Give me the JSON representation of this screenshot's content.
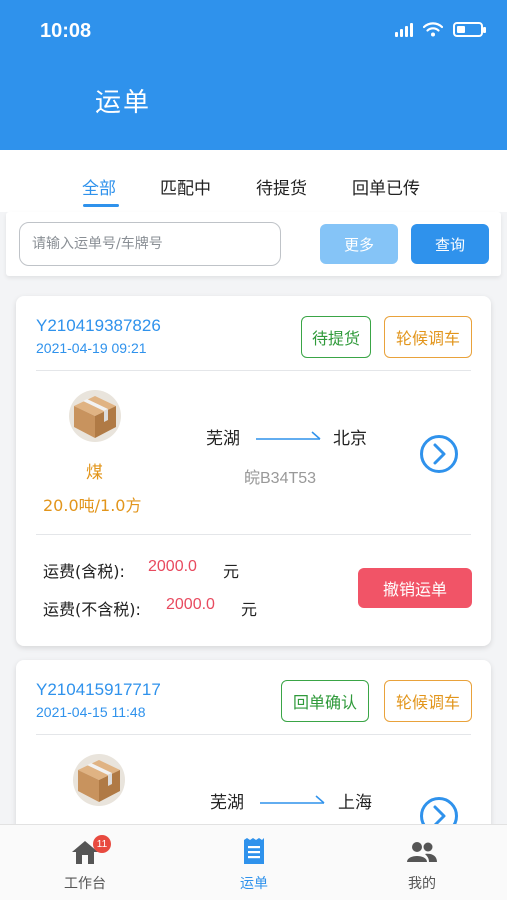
{
  "status_bar": {
    "time": "10:08"
  },
  "header": {
    "title": "运单"
  },
  "tabs": [
    {
      "label": "全部",
      "active": true
    },
    {
      "label": "匹配中",
      "active": false
    },
    {
      "label": "待提货",
      "active": false
    },
    {
      "label": "回单已传",
      "active": false
    }
  ],
  "search": {
    "placeholder": "请输入运单号/车牌号",
    "value": "",
    "more_label": "更多",
    "query_label": "查询"
  },
  "orders": [
    {
      "order_no": "Y210419387826",
      "time": "2021-04-19 09:21",
      "tags": [
        "待提货",
        "轮候调车"
      ],
      "cargo_name": "煤",
      "cargo_qty": "20.0吨/1.0方",
      "from": "芜湖",
      "to": "北京",
      "plate": "皖B34T53",
      "fee_tax_label": "运费(含税):",
      "fee_tax_value": "2000.0",
      "fee_notax_label": "运费(不含税):",
      "fee_notax_value": "2000.0",
      "fee_unit": "元",
      "cancel_label": "撤销运单"
    },
    {
      "order_no": "Y210415917717",
      "time": "2021-04-15 11:48",
      "tags": [
        "回单确认",
        "轮候调车"
      ],
      "from": "芜湖",
      "to": "上海"
    }
  ],
  "tabbar": [
    {
      "label": "工作台",
      "icon": "home-icon",
      "badge": "11",
      "active": false
    },
    {
      "label": "运单",
      "icon": "document-icon",
      "active": true
    },
    {
      "label": "我的",
      "icon": "users-icon",
      "active": false
    }
  ],
  "colors": {
    "primary": "#2f92ec",
    "tag_green": "#2f9a3a",
    "tag_orange": "#e2951b",
    "danger": "#f15467"
  }
}
